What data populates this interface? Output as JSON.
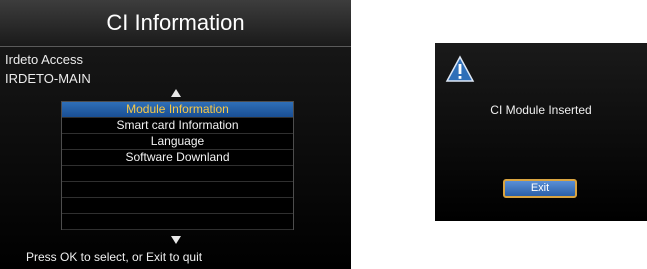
{
  "ci_panel": {
    "title": "CI Information",
    "provider": "Irdeto Access",
    "module_name": "IRDETO-MAIN",
    "menu_items": [
      {
        "label": "Module Information"
      },
      {
        "label": "Smart card Information"
      },
      {
        "label": "Language"
      },
      {
        "label": "Software Downland"
      }
    ],
    "selected_item": "Module Information",
    "help": "Press OK to select, or Exit to quit"
  },
  "dialog": {
    "icon": "warning-icon",
    "message": "CI Module Inserted",
    "exit_label": "Exit"
  },
  "colors": {
    "highlight_bg": "#2f6fb8",
    "highlight_text": "#f7c948",
    "button_border": "#d9a441"
  }
}
